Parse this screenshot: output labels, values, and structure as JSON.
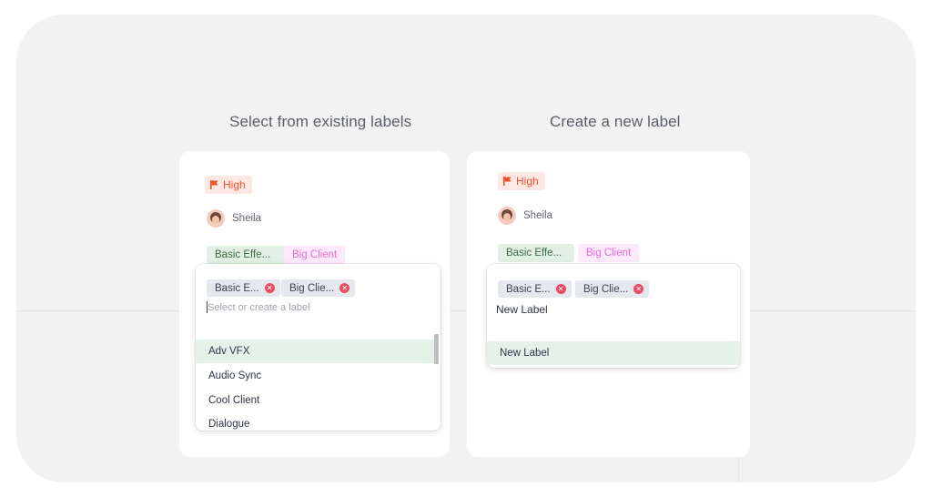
{
  "left_panel": {
    "heading": "Select from existing labels",
    "priority": "High",
    "assignee": "Sheila",
    "labels": [
      "Basic Effe...",
      "Big Client"
    ],
    "selected_chips": [
      "Basic E...",
      "Big Clie..."
    ],
    "search_placeholder": "Select or create a label",
    "options": [
      "Adv VFX",
      "Audio Sync",
      "Cool Client",
      "Dialogue"
    ]
  },
  "right_panel": {
    "heading": "Create a new label",
    "priority": "High",
    "assignee": "Sheila",
    "labels": [
      "Basic Effe...",
      "Big Client"
    ],
    "selected_chips": [
      "Basic E...",
      "Big Clie..."
    ],
    "typed_value": "New Label",
    "options": [
      "New Label"
    ]
  },
  "icons": {
    "priority": "flag-icon",
    "remove_chip": "close-circle-icon"
  },
  "colors": {
    "priority_text": "#f0512b",
    "priority_bg": "#fde8e3",
    "label_green_bg": "#e2f0e4",
    "label_pink_text": "#e46fd7",
    "chip_remove": "#e84b64",
    "active_option_bg": "#e4f2ea"
  }
}
